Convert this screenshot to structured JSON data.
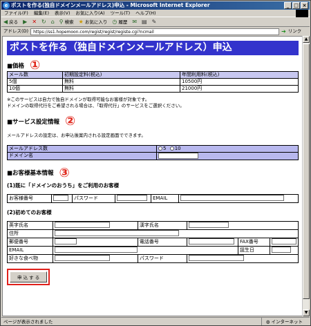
{
  "window": {
    "title": "ポストを作る(独自ドメインメールアドレス)申込 - Microsoft Internet Explorer",
    "controls": [
      "_",
      "□",
      "×"
    ]
  },
  "menubar": {
    "items": [
      "ファイル(F)",
      "編集(E)",
      "表示(V)",
      "お気に入り(A)",
      "ツール(T)",
      "ヘルプ(H)"
    ]
  },
  "toolbar": {
    "back": "戻る",
    "search": "検索",
    "favorites": "お気に入り",
    "history": "履歴",
    "links_label": "リンク"
  },
  "address": {
    "label": "アドレス(D)",
    "url": "https://ss1.hopemoon.com/regist/regist/registe.cgi?ncmail"
  },
  "page": {
    "title": "ポストを作る（独自ドメインメールアドレス）申込",
    "price_section": {
      "heading": "■価格",
      "badge": "①",
      "headers": [
        "メール数",
        "初期設定料(税込)",
        "年間利用料(税込)"
      ],
      "rows": [
        [
          "5個",
          "無料",
          "10500円"
        ],
        [
          "10個",
          "無料",
          "21000円"
        ]
      ],
      "note_line1": "※このサービスは自力で独自ドメインが取得可能なお客様が対象です。",
      "note_line2": "ドメインの取得代行をご希望される場合は、「取得代行」のサービスをご選択ください。"
    },
    "service_section": {
      "heading": "■サービス設定情報",
      "badge": "②",
      "description": "メールアドレスの設定は、お申込後案内される設定画面でできます。",
      "mail_count_label": "メールアドレス数",
      "radio_option_1": "5",
      "radio_option_2": "10",
      "domain_label": "ドメイン名"
    },
    "customer_section": {
      "heading": "■お客様基本情報",
      "badge": "③",
      "existing_title": "(1)既に「ドメインのおうち」をご利用のお客様",
      "customer_no_label": "お客様番号",
      "password_label": "パスワード",
      "email_label": "EMAIL",
      "new_title": "(2)初めてのお客様",
      "english_name_label": "英字氏名",
      "kanji_name_label": "漢字氏名",
      "address_label": "住所",
      "zip_label": "郵便番号",
      "phone_label": "電話番号",
      "fax_label": "FAX番号",
      "email2_label": "EMAIL",
      "birthday_label": "誕生日",
      "food_label": "好きな食べ物",
      "password2_label": "パスワード"
    },
    "submit_label": "申 込 す る"
  },
  "status": {
    "left": "ページが表示されました",
    "zone": "インターネット"
  }
}
